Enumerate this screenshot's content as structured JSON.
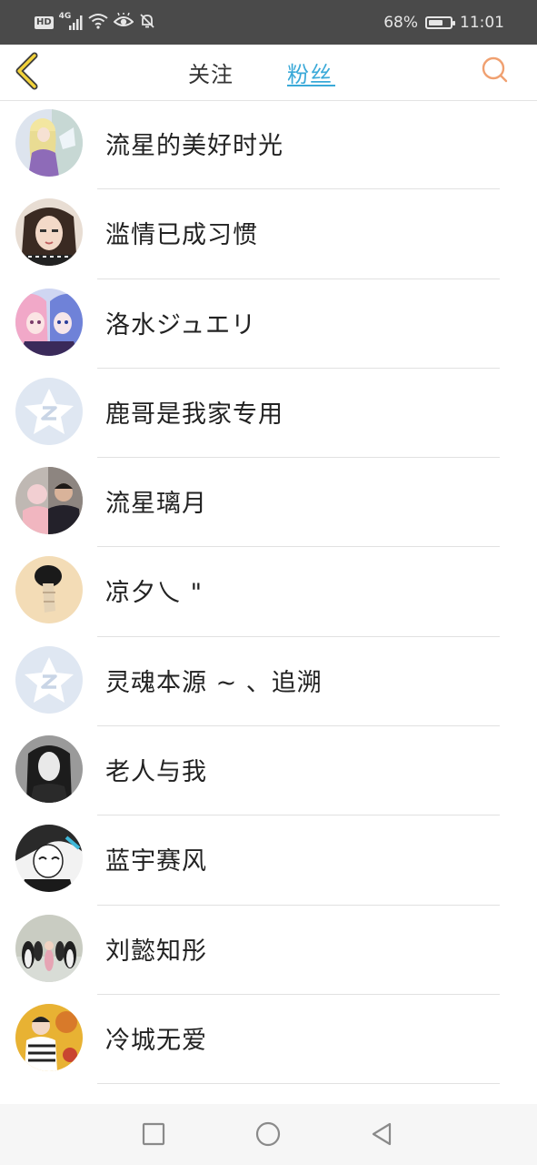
{
  "status_bar": {
    "network_badge": "HD",
    "network_type": "4G",
    "battery_percent": "68%",
    "battery_level": 0.68,
    "time": "11:01"
  },
  "header": {
    "tabs": [
      {
        "label": "关注",
        "active": false
      },
      {
        "label": "粉丝",
        "active": true
      }
    ],
    "accent_color": "#3aa9d8",
    "back_icon": "chevron-left-icon",
    "search_icon": "search-icon"
  },
  "followers": [
    {
      "name": "流星的美好时光",
      "avatar": "anime-girl-purple"
    },
    {
      "name": "滥情已成习惯",
      "avatar": "photo-girl"
    },
    {
      "name": "洛水ジュエリ",
      "avatar": "anime-girls-pink-blue"
    },
    {
      "name": "鹿哥是我家专用",
      "avatar": "default-qzone"
    },
    {
      "name": "流星璃月",
      "avatar": "photo-family"
    },
    {
      "name": "凉夕乀 \"",
      "avatar": "illustration-figure"
    },
    {
      "name": "灵魂本源 ~ 、追溯",
      "avatar": "default-qzone"
    },
    {
      "name": "老人与我",
      "avatar": "photo-bw-girl"
    },
    {
      "name": "蓝宇赛风",
      "avatar": "manga-girl-bw"
    },
    {
      "name": "刘懿知彤",
      "avatar": "photo-penguins"
    },
    {
      "name": "冷城无爱",
      "avatar": "photo-child-yellow"
    }
  ],
  "nav_bar": {
    "recent_icon": "square-icon",
    "home_icon": "circle-icon",
    "back_icon": "triangle-back-icon"
  }
}
